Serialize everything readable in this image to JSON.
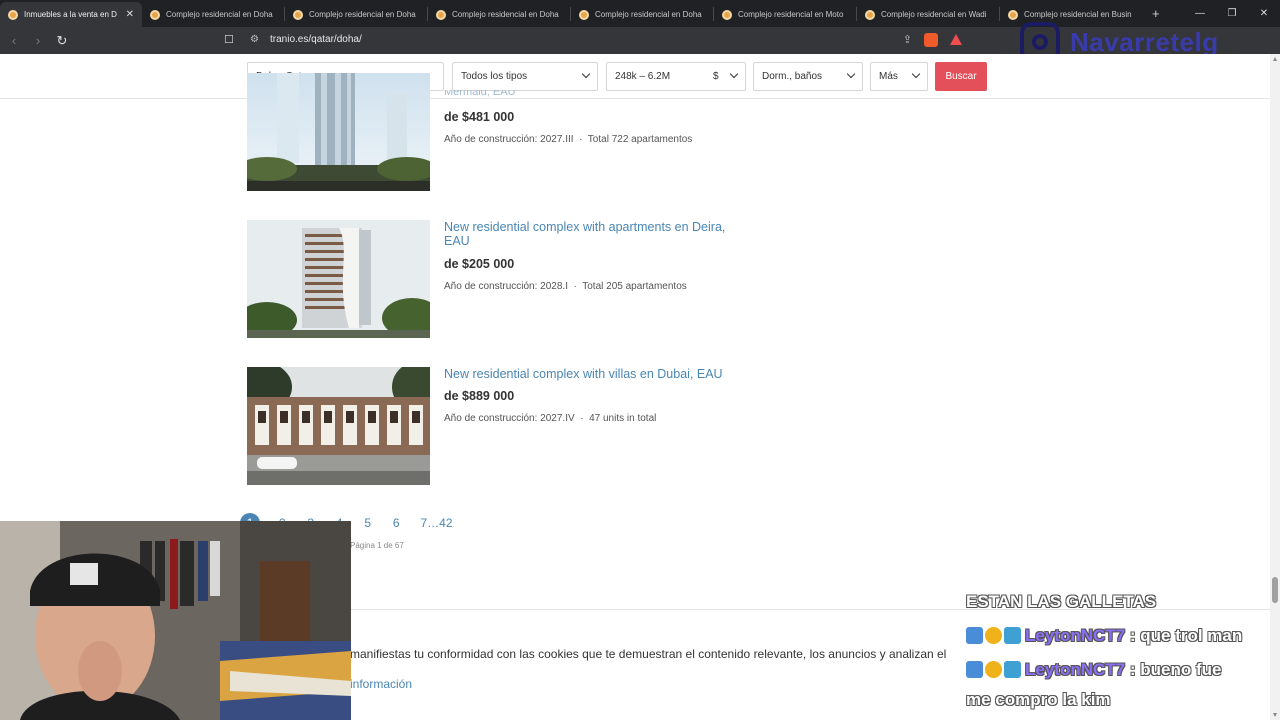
{
  "browser": {
    "tabs": [
      {
        "label": "Inmuebles a la venta en D",
        "active": true
      },
      {
        "label": "Complejo residencial en Doha"
      },
      {
        "label": "Complejo residencial en Doha"
      },
      {
        "label": "Complejo residencial en Doha"
      },
      {
        "label": "Complejo residencial en Doha"
      },
      {
        "label": "Complejo residencial en Moto"
      },
      {
        "label": "Complejo residencial en Wadi"
      },
      {
        "label": "Complejo residencial en Busin"
      }
    ],
    "url": "tranio.es/qatar/doha/"
  },
  "overlay": {
    "instagram_handle": "Navarretelg"
  },
  "filters": {
    "location": "Doha, Qatar",
    "type": "Todos los tipos",
    "price_range": "248k – 6.2M",
    "currency": "$",
    "rooms": "Dorm., baños",
    "more": "Más",
    "search_button": "Buscar"
  },
  "listings": [
    {
      "title_partial": "Mermaid, EAU",
      "price": "de $481 000",
      "year": "Año de construcción: 2027.III",
      "total": "Total 722 apartamentos"
    },
    {
      "title": "New residential complex with apartments en Deira, EAU",
      "price": "de $205 000",
      "year": "Año de construcción: 2028.I",
      "total": "Total 205 apartamentos"
    },
    {
      "title": "New residential complex with villas en Dubai, EAU",
      "price": "de $889 000",
      "year": "Año de construcción: 2027.IV",
      "total": "47 units in total"
    }
  ],
  "pagination": {
    "pages": [
      "1",
      "2",
      "3",
      "4",
      "5",
      "6",
      "7…42"
    ],
    "info": "Página 1 de 67"
  },
  "cookie": {
    "text": "manifiestas tu conformidad con las cookies que te demuestran el contenido relevante, los anuncios y analizan el",
    "link": "información"
  },
  "chat": {
    "lines": [
      {
        "text": "ESTAN LAS GALLETAS"
      },
      {
        "user": "LeytonNCT7",
        "message": ": que trol man"
      },
      {
        "user": "LeytonNCT7",
        "message": ": bueno fue"
      },
      {
        "text": "me compro la kim"
      }
    ]
  },
  "colors": {
    "accent_red": "#e3505a",
    "link_blue": "#4a86b4"
  }
}
